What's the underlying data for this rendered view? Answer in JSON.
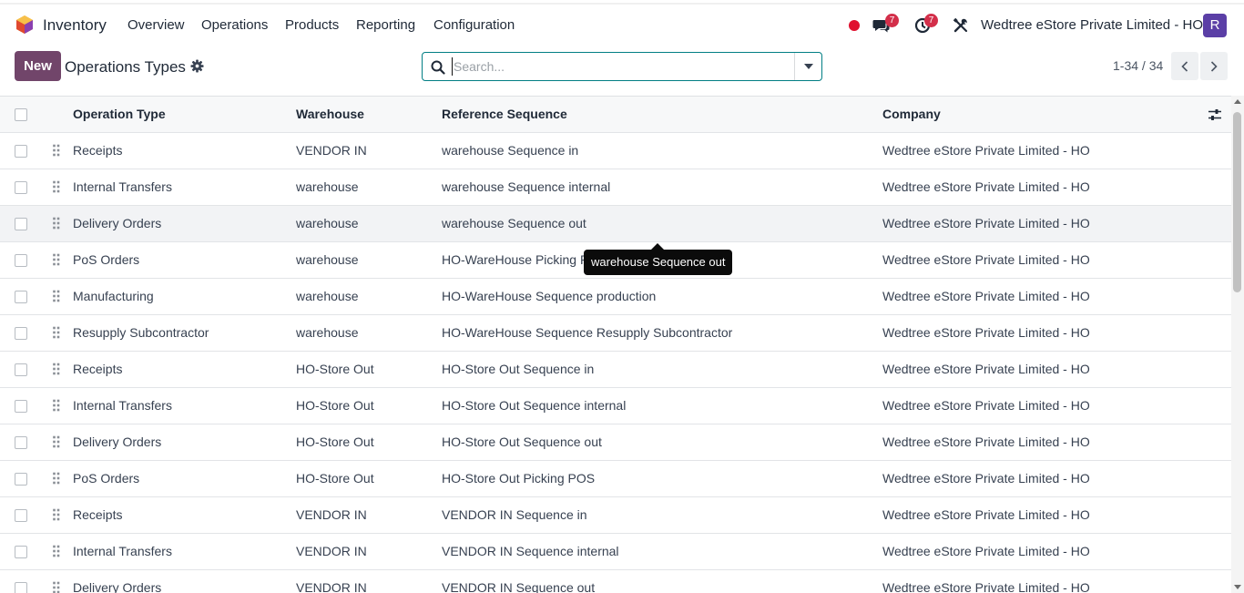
{
  "app": {
    "name": "Inventory"
  },
  "menu": [
    "Overview",
    "Operations",
    "Products",
    "Reporting",
    "Configuration"
  ],
  "navbar": {
    "messages_count": "7",
    "activities_count": "7",
    "company": "Wedtree eStore Private Limited - HO",
    "avatar_letter": "R"
  },
  "control_panel": {
    "new_label": "New",
    "title": "Operations Types",
    "search_placeholder": "Search...",
    "pager": "1-34 / 34"
  },
  "columns": [
    "Operation Type",
    "Warehouse",
    "Reference Sequence",
    "Company"
  ],
  "rows": [
    [
      "Receipts",
      "VENDOR IN",
      "warehouse Sequence in",
      "Wedtree eStore Private Limited - HO"
    ],
    [
      "Internal Transfers",
      "warehouse",
      "warehouse Sequence internal",
      "Wedtree eStore Private Limited - HO"
    ],
    [
      "Delivery Orders",
      "warehouse",
      "warehouse Sequence out",
      "Wedtree eStore Private Limited - HO"
    ],
    [
      "PoS Orders",
      "warehouse",
      "HO-WareHouse Picking POS",
      "Wedtree eStore Private Limited - HO"
    ],
    [
      "Manufacturing",
      "warehouse",
      "HO-WareHouse Sequence production",
      "Wedtree eStore Private Limited - HO"
    ],
    [
      "Resupply Subcontractor",
      "warehouse",
      "HO-WareHouse Sequence Resupply Subcontractor",
      "Wedtree eStore Private Limited - HO"
    ],
    [
      "Receipts",
      "HO-Store Out",
      "HO-Store Out Sequence in",
      "Wedtree eStore Private Limited - HO"
    ],
    [
      "Internal Transfers",
      "HO-Store Out",
      "HO-Store Out Sequence internal",
      "Wedtree eStore Private Limited - HO"
    ],
    [
      "Delivery Orders",
      "HO-Store Out",
      "HO-Store Out Sequence out",
      "Wedtree eStore Private Limited - HO"
    ],
    [
      "PoS Orders",
      "HO-Store Out",
      "HO-Store Out Picking POS",
      "Wedtree eStore Private Limited - HO"
    ],
    [
      "Receipts",
      "VENDOR IN",
      "VENDOR IN Sequence in",
      "Wedtree eStore Private Limited - HO"
    ],
    [
      "Internal Transfers",
      "VENDOR IN",
      "VENDOR IN Sequence internal",
      "Wedtree eStore Private Limited - HO"
    ],
    [
      "Delivery Orders",
      "VENDOR IN",
      "VENDOR IN Sequence out",
      "Wedtree eStore Private Limited - HO"
    ]
  ],
  "hovered_row": 2,
  "tooltip": "warehouse Sequence out",
  "colors": {
    "brand": "#71456a",
    "accent": "#017e84",
    "badge": "#d32f4a"
  }
}
